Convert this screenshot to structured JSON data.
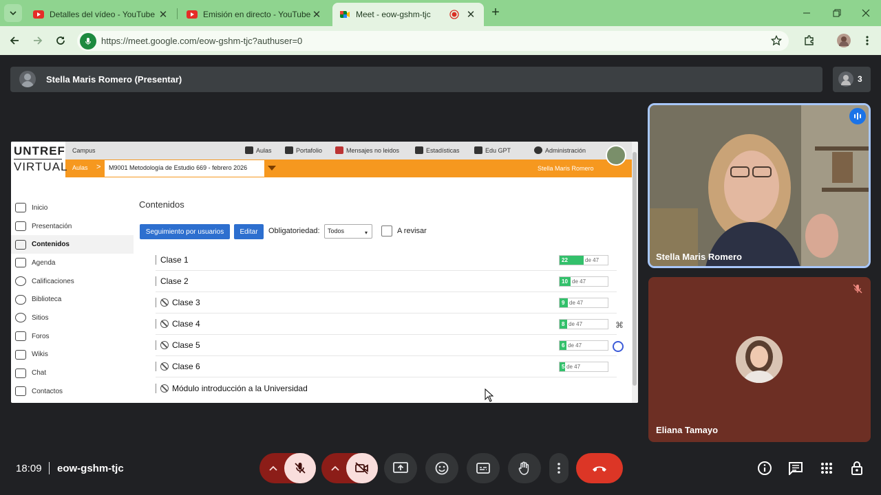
{
  "browser": {
    "tabs": [
      {
        "title": "Detalles del vídeo - YouTube St",
        "icon": "youtube-icon"
      },
      {
        "title": "Emisión en directo - YouTube St",
        "icon": "youtube-icon"
      },
      {
        "title": "Meet - eow-gshm-tjc",
        "icon": "google-meet-icon",
        "active": true,
        "recording": true
      }
    ],
    "url": "https://meet.google.com/eow-gshm-tjc?authuser=0"
  },
  "meet": {
    "presenter_label": "Stella Maris Romero (Presentar)",
    "participants_count": "3",
    "time": "18:09",
    "meeting_code": "eow-gshm-tjc",
    "tiles": [
      {
        "name": "Stella Maris Romero",
        "speaking": true
      },
      {
        "name": "Eliana Tamayo",
        "muted": true
      }
    ]
  },
  "lms": {
    "logo_top": "UNTREF",
    "logo_bottom": "VIRTUAL",
    "campus": "Campus",
    "nav": [
      "Aulas",
      "Portafolio",
      "Mensajes no leidos",
      "Estadísticas",
      "Edu GPT",
      "Administración"
    ],
    "breadcrumb_root": "Aulas",
    "breadcrumb_arrow": ">",
    "course": "M9001 Metodología de Estudio 669 - febrero 2026",
    "user": "Stella Maris Romero",
    "sidebar": [
      "Inicio",
      "Presentación",
      "Contenidos",
      "Agenda",
      "Calificaciones",
      "Biblioteca",
      "Sitios",
      "Foros",
      "Wikis",
      "Chat",
      "Contactos"
    ],
    "active_sidebar": "Contenidos",
    "page_title": "Contenidos",
    "btn_tracking": "Seguimiento por usuarios",
    "btn_edit": "Editar",
    "oblig_label": "Obligatoriedad:",
    "oblig_value": "Todos",
    "review_label": "A revisar",
    "items": [
      {
        "title": "Clase 1",
        "blocked": false,
        "done": "22",
        "total": "de 47"
      },
      {
        "title": "Clase 2",
        "blocked": false,
        "done": "10",
        "total": "de 47"
      },
      {
        "title": "Clase 3",
        "blocked": true,
        "done": "9",
        "total": "de 47"
      },
      {
        "title": "Clase 4",
        "blocked": true,
        "done": "8",
        "total": "de 47"
      },
      {
        "title": "Clase 5",
        "blocked": true,
        "done": "6",
        "total": "de 47"
      },
      {
        "title": "Clase 6",
        "blocked": true,
        "done": "5",
        "total": "de 47"
      },
      {
        "title": "Módulo introducción a la Universidad",
        "blocked": true
      }
    ]
  }
}
